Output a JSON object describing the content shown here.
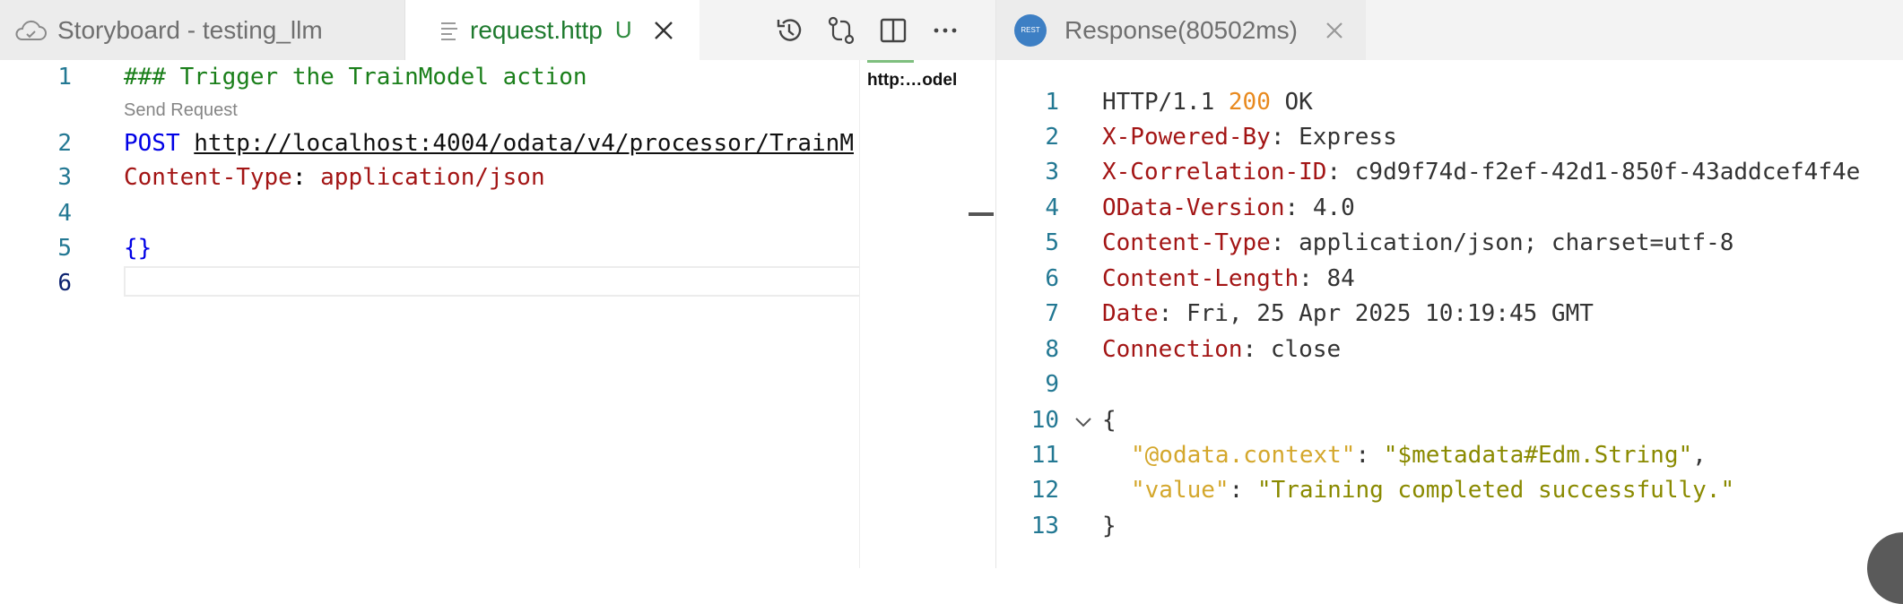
{
  "left_tabs": {
    "storyboard": "Storyboard - testing_llm",
    "request": "request.http",
    "request_status": "U"
  },
  "editor": {
    "codelens": "Send Request",
    "line_numbers": [
      "1",
      "2",
      "3",
      "4",
      "5",
      "6"
    ],
    "comment": "### Trigger the TrainModel action",
    "method": "POST",
    "url": "http://localhost:4004/odata/v4/processor/TrainM",
    "header_name": "Content-Type",
    "header_value": "application/json",
    "body": "{}"
  },
  "minimap": {
    "hover_text": "http:…odel"
  },
  "response_tab": {
    "title": "Response(80502ms)",
    "icon_text": "REST"
  },
  "response": {
    "line_numbers": [
      "1",
      "2",
      "3",
      "4",
      "5",
      "6",
      "7",
      "8",
      "9",
      "10",
      "11",
      "12",
      "13"
    ],
    "protocol": "HTTP/1.1",
    "status_code": "200",
    "status_text": "OK",
    "headers": [
      {
        "name": "X-Powered-By",
        "value": "Express"
      },
      {
        "name": "X-Correlation-ID",
        "value": "c9d9f74d-f2ef-42d1-850f-43addcef4f4e"
      },
      {
        "name": "OData-Version",
        "value": "4.0"
      },
      {
        "name": "Content-Type",
        "value": "application/json; charset=utf-8"
      },
      {
        "name": "Content-Length",
        "value": "84"
      },
      {
        "name": "Date",
        "value": "Fri, 25 Apr 2025 10:19:45 GMT"
      },
      {
        "name": "Connection",
        "value": "close"
      }
    ],
    "body_open": "{",
    "body_close": "}",
    "json": [
      {
        "key": "\"@odata.context\"",
        "value": "\"$metadata#Edm.String\"",
        "trail": ","
      },
      {
        "key": "\"value\"",
        "value": "\"Training completed successfully.\"",
        "trail": ""
      }
    ]
  },
  "colors": {
    "header_name": "#a31515",
    "status_code": "#e8891e",
    "json_key": "#d4a72c",
    "json_string": "#8a8a00",
    "comment": "#1a7f1a",
    "method": "#0000e6"
  }
}
